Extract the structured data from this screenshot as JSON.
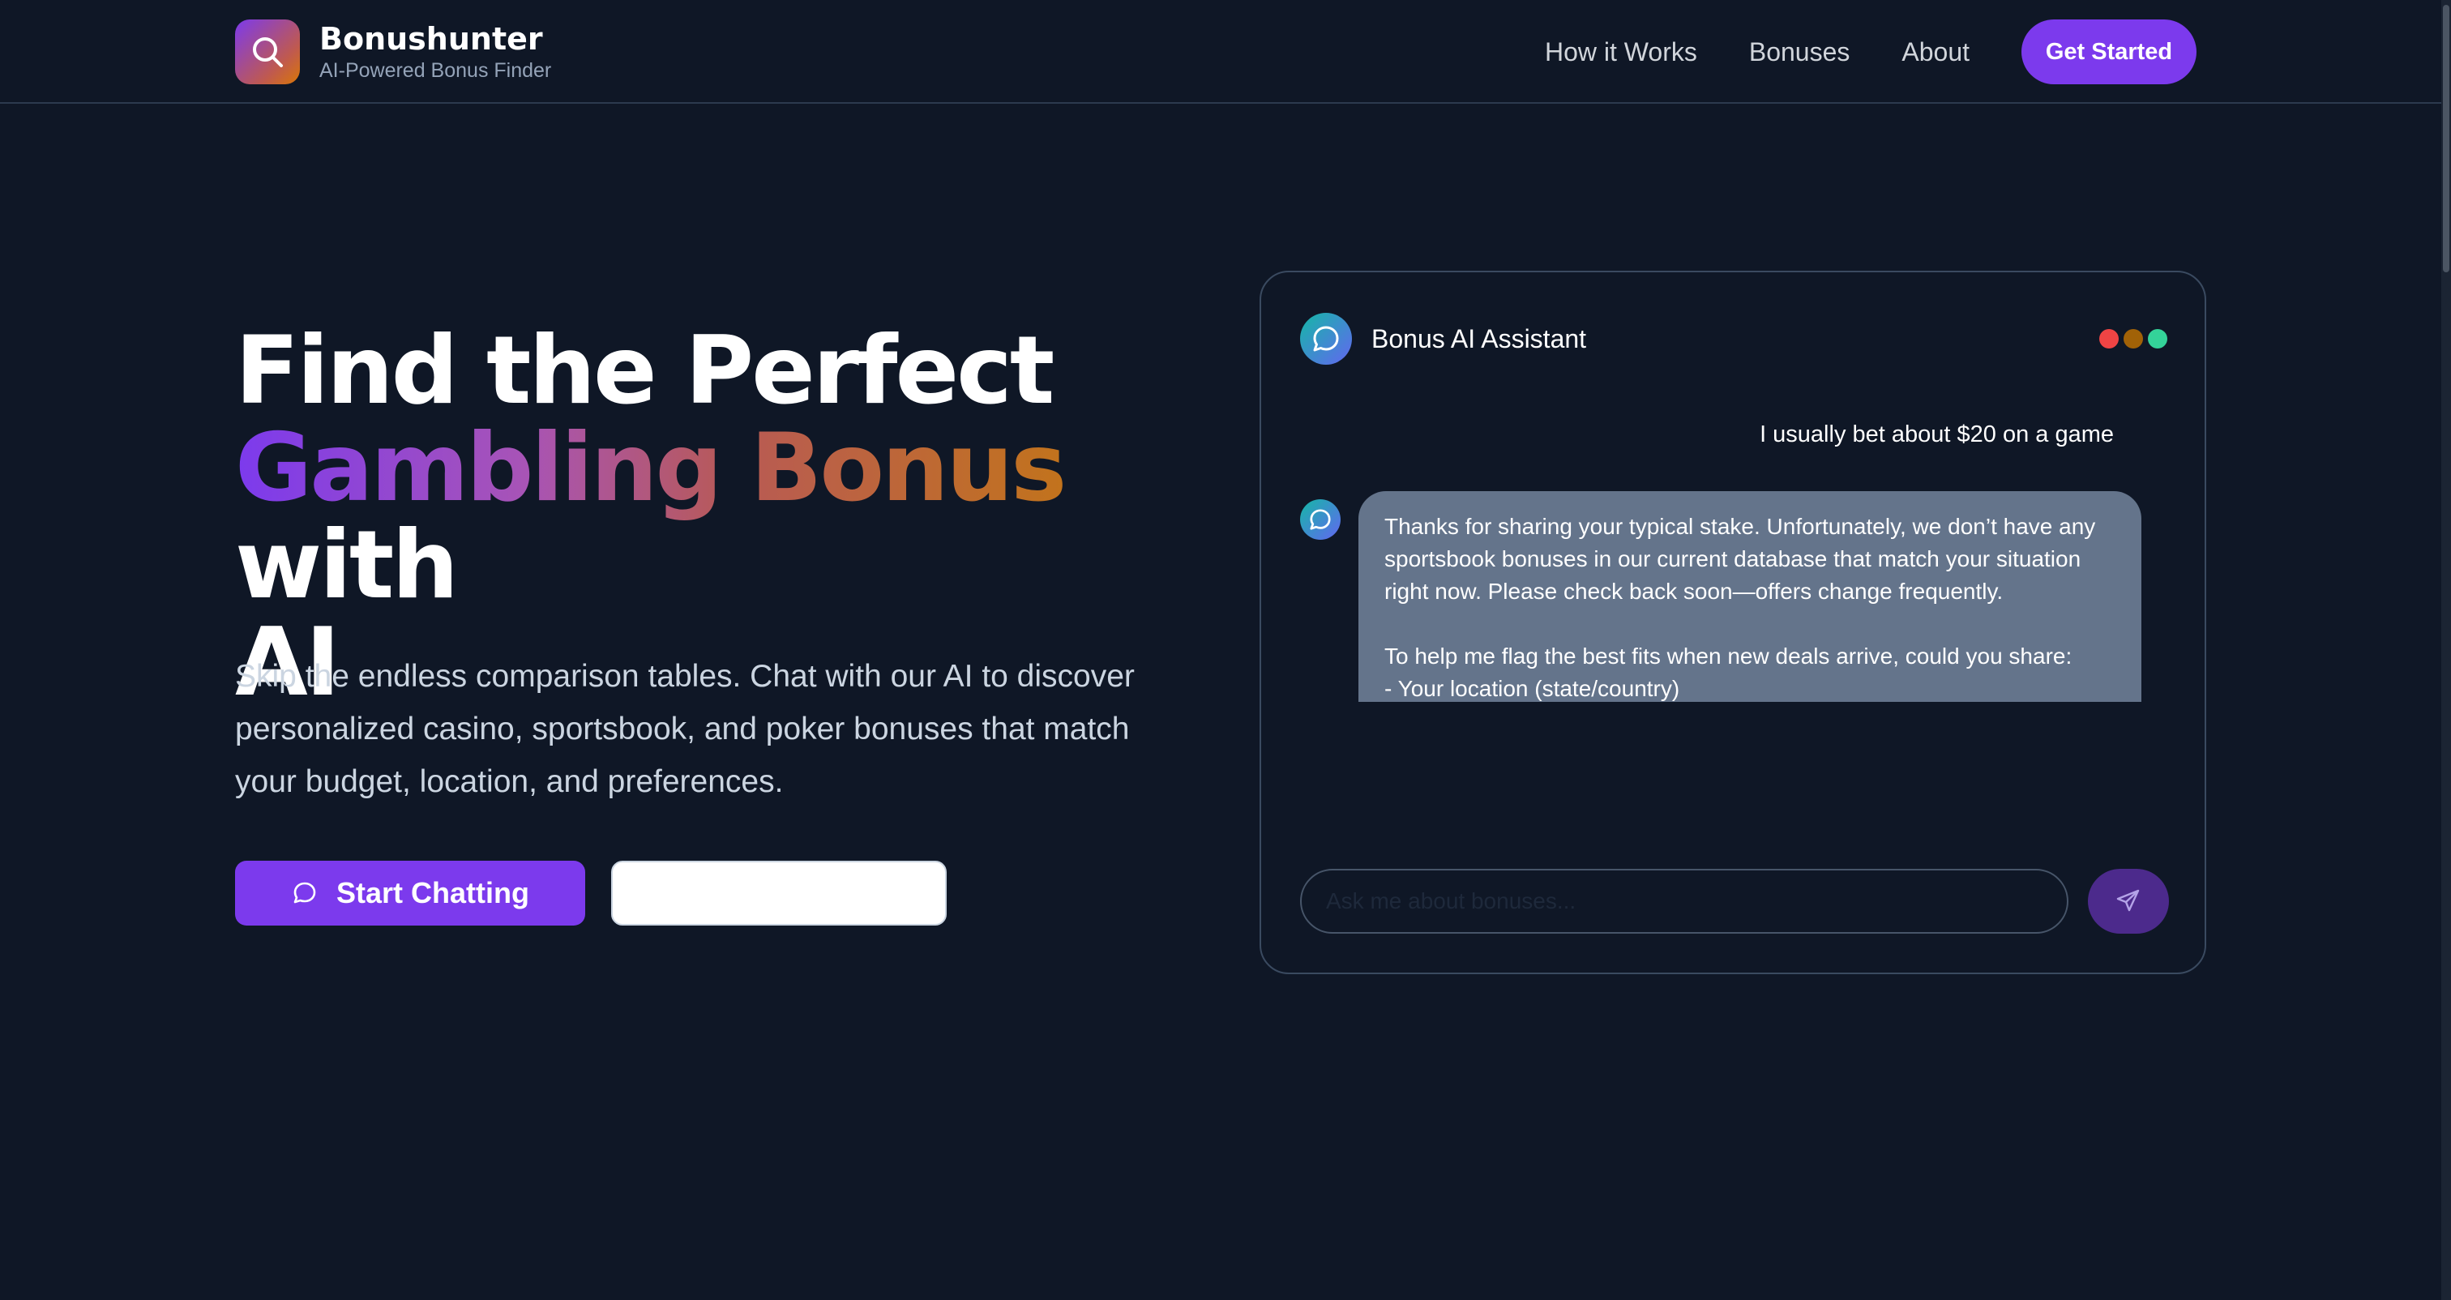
{
  "nav": {
    "brand_name": "Bonushunter",
    "brand_tagline": "AI-Powered Bonus Finder",
    "links": [
      "How it Works",
      "Bonuses",
      "About"
    ],
    "cta": "Get Started"
  },
  "hero": {
    "title_line1": "Find the Perfect",
    "title_gradient": "Gambling Bonus",
    "title_with": "with",
    "title_line3": "AI",
    "subtitle": "Skip the endless comparison tables. Chat with our AI to discover personalized casino, sportsbook, and poker bonuses that match your budget, location, and preferences.",
    "primary_button": "Start Chatting",
    "secondary_button": ""
  },
  "chat": {
    "title": "Bonus AI Assistant",
    "window_dots": [
      "#ef4444",
      "#a16207",
      "#34d399"
    ],
    "user_message": "I usually bet about $20 on a game",
    "bot_message": "Thanks for sharing your typical stake. Unfortunately, we don’t have any sportsbook bonuses in our current database that match your situation right now. Please check back soon—offers change frequently.\n\nTo help me flag the best fits when new deals arrive, could you share:\n- Your location (state/country)\n- Which sportsbook(s) you use\n- The types of promos you like (e.g., bet insurance, odds boosts, deposit matches)",
    "input_placeholder": "Ask me about bonuses...",
    "send_icon": "paper-plane-icon"
  },
  "colors": {
    "background": "#0f1726",
    "accent": "#7c3aed",
    "bubble": "#64748b"
  }
}
